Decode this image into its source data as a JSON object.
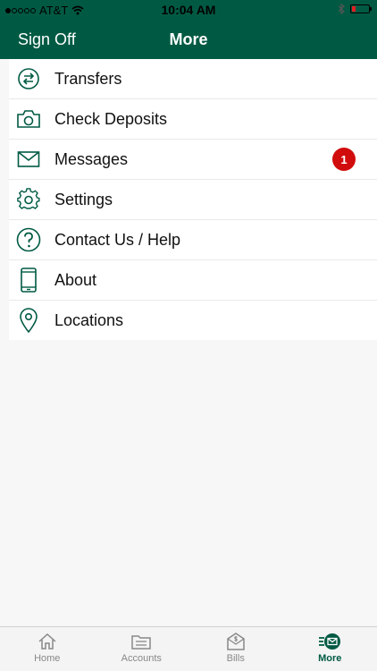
{
  "status_bar": {
    "carrier": "AT&T",
    "time": "10:04 AM"
  },
  "nav": {
    "left_button": "Sign Off",
    "title": "More"
  },
  "menu": [
    {
      "label": "Transfers",
      "icon": "transfer-arrows-icon"
    },
    {
      "label": "Check Deposits",
      "icon": "camera-icon"
    },
    {
      "label": "Messages",
      "icon": "envelope-icon",
      "badge": "1"
    },
    {
      "label": "Settings",
      "icon": "gear-icon"
    },
    {
      "label": "Contact Us / Help",
      "icon": "question-icon"
    },
    {
      "label": "About",
      "icon": "phone-icon"
    },
    {
      "label": "Locations",
      "icon": "location-pin-icon"
    }
  ],
  "tabs": [
    {
      "label": "Home",
      "icon": "home-icon"
    },
    {
      "label": "Accounts",
      "icon": "accounts-icon"
    },
    {
      "label": "Bills",
      "icon": "bills-icon"
    },
    {
      "label": "More",
      "icon": "more-icon",
      "active": true
    }
  ],
  "colors": {
    "brand": "#005a43",
    "badge": "#d10c0c"
  }
}
